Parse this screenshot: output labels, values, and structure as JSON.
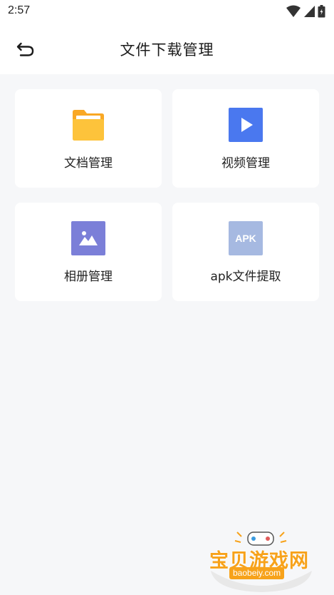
{
  "status_bar": {
    "time": "2:57",
    "icons": [
      "wifi-icon",
      "signal-icon",
      "battery-icon"
    ]
  },
  "header": {
    "title": "文件下载管理",
    "back_icon": "back-icon"
  },
  "cards": [
    {
      "label": "文档管理",
      "icon": "folder-icon",
      "color": "#fbb72d"
    },
    {
      "label": "视频管理",
      "icon": "video-play-icon",
      "color": "#4a78ef"
    },
    {
      "label": "相册管理",
      "icon": "photo-album-icon",
      "color": "#7b7fd8"
    },
    {
      "label": "apk文件提取",
      "icon": "apk-icon",
      "icon_text": "APK",
      "color": "#a6b9e1"
    }
  ],
  "watermark": {
    "name": "宝贝游戏网",
    "url": "baobeiy.com"
  }
}
